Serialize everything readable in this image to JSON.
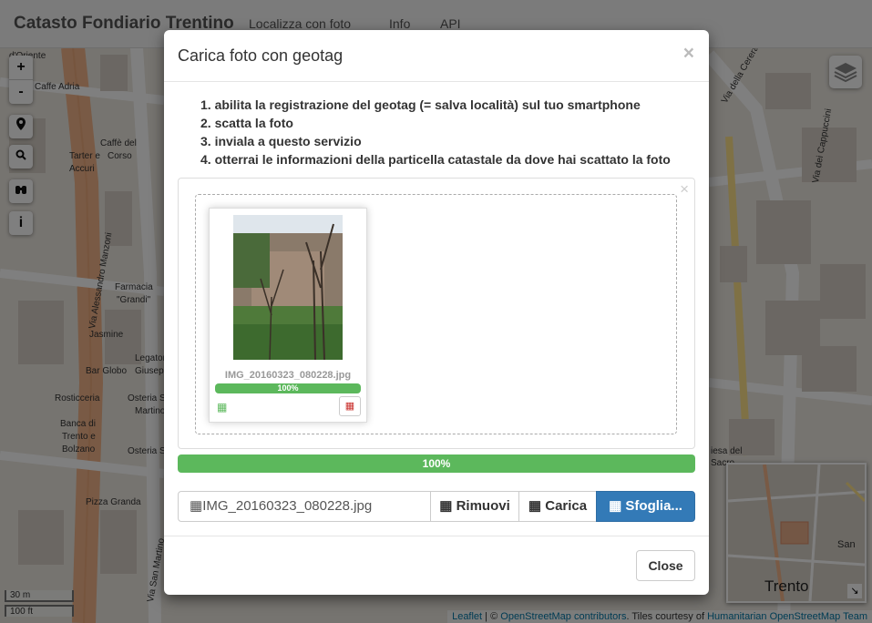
{
  "navbar": {
    "brand": "Catasto Fondiario Trentino",
    "links": [
      "Localizza con foto",
      "Info",
      "API"
    ]
  },
  "map_controls": {
    "zoom_in": "+",
    "zoom_out": "-",
    "info": "i"
  },
  "map_labels": {
    "l1": "d'Oriente",
    "l2": "Caffe Adria",
    "l3": "Caffè del",
    "l4": "Corso",
    "l5": "Tarter e",
    "l6": "Accuri",
    "l7": "Farmacia",
    "l8": "\"Grandi\"",
    "l9": "Jasmine",
    "l10": "Bar Globo",
    "l11": "Legatori",
    "l12": "Giusep",
    "l13": "Rosticceria",
    "l14": "Osteria Sa",
    "l15": "Martino",
    "l16": "Banca di",
    "l17": "Trento e",
    "l18": "Bolzano",
    "l19": "Osteria San",
    "l20": "Pizza Granda",
    "l21": "Via della Cerera",
    "l22": "Via dei Cappuccini",
    "l23": "Via Alessandro Manzoni",
    "l24": "Via San Martino",
    "l25": "iesa del",
    "l26": "Sacro"
  },
  "minimap": {
    "city": "Trento",
    "place": "San"
  },
  "scale": {
    "metric": "30 m",
    "imperial": "100 ft"
  },
  "attribution": {
    "leaflet": "Leaflet",
    "sep": "| ©",
    "osm": "OpenStreetMap contributors",
    "tiles": ". Tiles courtesy of",
    "hot": "Humanitarian OpenStreetMap Team"
  },
  "modal": {
    "title": "Carica foto con geotag",
    "close_x": "×",
    "steps": [
      "1. abilita la registrazione del geotag (= salva località) sul tuo smartphone",
      "2. scatta la foto",
      "3. inviala a questo servizio",
      "4. otterrai le informazioni della particella catastale da dove hai scattato la foto"
    ],
    "file_close": "×",
    "file": {
      "name": "IMG_20160323_080228.jpg",
      "progress_label": "100%",
      "progress": 100
    },
    "main_progress_label": "100%",
    "main_progress": 100,
    "caption": "IMG_20160323_080228.jpg",
    "btn_remove": "Rimuovi",
    "btn_upload": "Carica",
    "btn_browse": "Sfoglia...",
    "footer_close": "Close"
  },
  "colors": {
    "success": "#5cb85c",
    "primary": "#337ab7",
    "danger": "#c9302c"
  }
}
